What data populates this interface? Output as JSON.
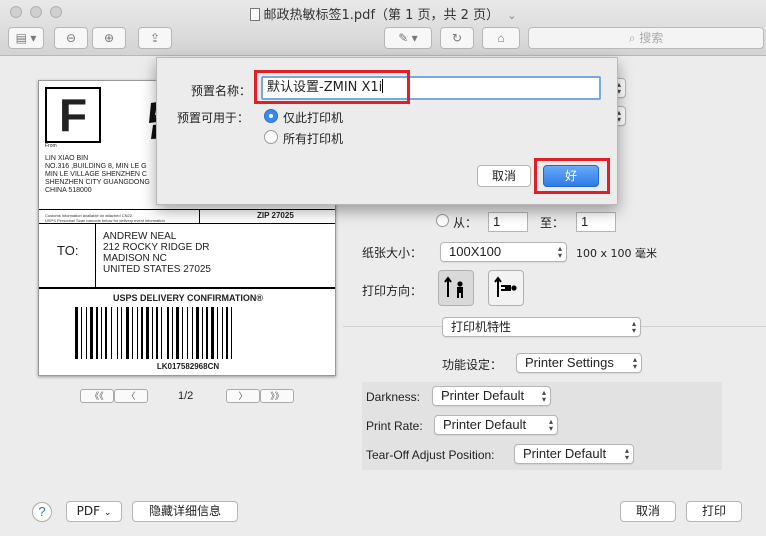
{
  "window": {
    "title": "邮政热敏标签1.pdf（第 1 页，共 2 页）",
    "title_chevron": "⌄",
    "search_placeholder": "搜索"
  },
  "preview": {
    "big_letter": "F",
    "from": "From",
    "sender_lines": [
      "LIN XIAO BIN",
      "NO.316 ,BUILDING 8, MIN LE G",
      "MIN LE VILLAGE SHENZHEN C",
      "SHENZHEN CITY GUANGDONG",
      "CHINA 518000"
    ],
    "customs_note": [
      "Customs information available on attached CN22.",
      "USPS Personnel Scan barcode below for delivery event information"
    ],
    "zip": "ZIP 27025",
    "to_label": "TO:",
    "recipient_lines": [
      "ANDREW NEAL",
      "212 ROCKY RIDGE DR",
      "MADISON NC",
      "UNITED STATES 27025"
    ],
    "confirmation": "USPS DELIVERY CONFIRMATION",
    "tracking": "LK017582968CN",
    "page_indicator": "1/2",
    "pager_first": "《《",
    "pager_prev": "〈",
    "pager_next": "〉",
    "pager_last": "》》"
  },
  "panel": {
    "from_label": "从：",
    "from_value": "1",
    "to_label": "至：",
    "to_value": "1",
    "paper_size_label": "纸张大小：",
    "paper_size_value": "100X100",
    "paper_size_dims": "100 x 100 毫米",
    "orientation_label": "打印方向：",
    "section_value": "打印机特性",
    "feature_label": "功能设定：",
    "feature_value": "Printer Settings",
    "darkness_label": "Darkness:",
    "darkness_value": "Printer Default",
    "print_rate_label": "Print Rate:",
    "print_rate_value": "Printer Default",
    "tearoff_label": "Tear-Off Adjust Position:",
    "tearoff_value": "Printer Default"
  },
  "bottom": {
    "help": "?",
    "pdf": "PDF",
    "hide_details": "隐藏详细信息",
    "cancel": "取消",
    "print": "打印"
  },
  "modal": {
    "name_label": "预置名称：",
    "name_value": "默认设置-ZMIN X1i",
    "available_label": "预置可用于：",
    "option_this": "仅此打印机",
    "option_all": "所有打印机",
    "cancel": "取消",
    "ok": "好"
  }
}
